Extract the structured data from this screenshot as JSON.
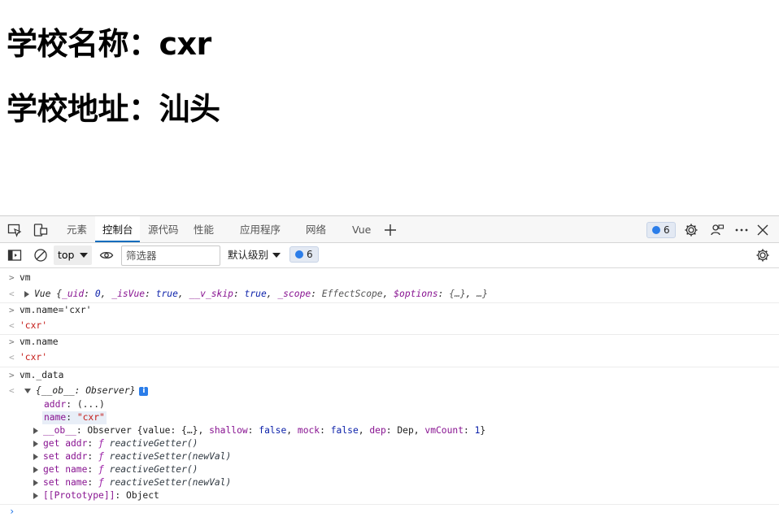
{
  "page": {
    "school_name_label": "学校名称：cxr",
    "school_addr_label": "学校地址：汕头"
  },
  "devtools": {
    "tabs": [
      "元素",
      "控制台",
      "源代码",
      "性能",
      "应用程序",
      "网络",
      "Vue"
    ],
    "active_tab": "控制台",
    "issues_count": "6",
    "toolbar": {
      "context": "top",
      "filter_placeholder": "筛选器",
      "levels": "默认级别",
      "issues_count": "6"
    },
    "console": {
      "l1_in": "vm",
      "l1_out_prefix": "Vue {",
      "l1_out_k1": "_uid",
      "l1_out_v1": "0",
      "l1_out_k2": "_isVue",
      "l1_out_v2": "true",
      "l1_out_k3": "__v_skip",
      "l1_out_v3": "true",
      "l1_out_k4": "_scope",
      "l1_out_v4": "EffectScope",
      "l1_out_k5": "$options",
      "l1_out_v5": "{…}",
      "l1_out_tail": "…}",
      "l2_in": "vm.name='cxr'",
      "l2_out": "'cxr'",
      "l3_in": "vm.name",
      "l3_out": "'cxr'",
      "l4_in": "vm._data",
      "l4_out_head": "{__ob__: Observer}",
      "addr_key": "addr",
      "addr_val": "(...)",
      "name_key": "name",
      "name_val": "\"cxr\"",
      "ob_key": "__ob__",
      "ob_val_prefix": "Observer {value: {…}, ",
      "ob_shallow": "shallow",
      "ob_shallow_v": "false",
      "ob_mock": "mock",
      "ob_mock_v": "false",
      "ob_dep": "dep",
      "ob_dep_v": "Dep",
      "ob_vmcount": "vmCount",
      "ob_vmcount_v": "1",
      "get_addr": "get addr",
      "set_addr": "set addr",
      "get_name": "get name",
      "set_name": "set name",
      "f_sym": "ƒ",
      "getter": "reactiveGetter()",
      "setter": "reactiveSetter(newVal)",
      "proto_key": "[[Prototype]]",
      "proto_val": "Object"
    }
  },
  "colors": {
    "accent": "#0f6cbd",
    "badge_dot": "#2b7de9",
    "string_red": "#c41a16",
    "key_purple": "#881391"
  }
}
